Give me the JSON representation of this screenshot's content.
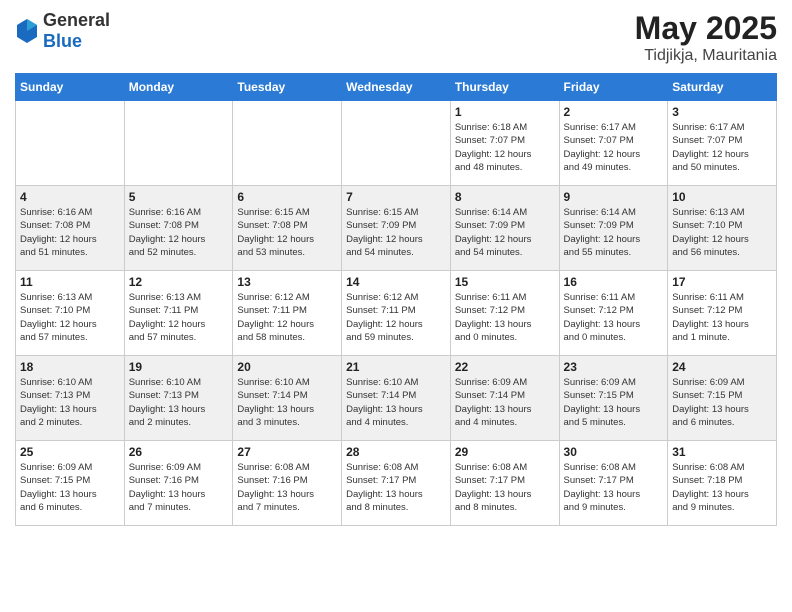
{
  "header": {
    "logo_general": "General",
    "logo_blue": "Blue",
    "month": "May 2025",
    "location": "Tidjikja, Mauritania"
  },
  "days_of_week": [
    "Sunday",
    "Monday",
    "Tuesday",
    "Wednesday",
    "Thursday",
    "Friday",
    "Saturday"
  ],
  "weeks": [
    [
      {
        "day": "",
        "info": ""
      },
      {
        "day": "",
        "info": ""
      },
      {
        "day": "",
        "info": ""
      },
      {
        "day": "",
        "info": ""
      },
      {
        "day": "1",
        "info": "Sunrise: 6:18 AM\nSunset: 7:07 PM\nDaylight: 12 hours\nand 48 minutes."
      },
      {
        "day": "2",
        "info": "Sunrise: 6:17 AM\nSunset: 7:07 PM\nDaylight: 12 hours\nand 49 minutes."
      },
      {
        "day": "3",
        "info": "Sunrise: 6:17 AM\nSunset: 7:07 PM\nDaylight: 12 hours\nand 50 minutes."
      }
    ],
    [
      {
        "day": "4",
        "info": "Sunrise: 6:16 AM\nSunset: 7:08 PM\nDaylight: 12 hours\nand 51 minutes."
      },
      {
        "day": "5",
        "info": "Sunrise: 6:16 AM\nSunset: 7:08 PM\nDaylight: 12 hours\nand 52 minutes."
      },
      {
        "day": "6",
        "info": "Sunrise: 6:15 AM\nSunset: 7:08 PM\nDaylight: 12 hours\nand 53 minutes."
      },
      {
        "day": "7",
        "info": "Sunrise: 6:15 AM\nSunset: 7:09 PM\nDaylight: 12 hours\nand 54 minutes."
      },
      {
        "day": "8",
        "info": "Sunrise: 6:14 AM\nSunset: 7:09 PM\nDaylight: 12 hours\nand 54 minutes."
      },
      {
        "day": "9",
        "info": "Sunrise: 6:14 AM\nSunset: 7:09 PM\nDaylight: 12 hours\nand 55 minutes."
      },
      {
        "day": "10",
        "info": "Sunrise: 6:13 AM\nSunset: 7:10 PM\nDaylight: 12 hours\nand 56 minutes."
      }
    ],
    [
      {
        "day": "11",
        "info": "Sunrise: 6:13 AM\nSunset: 7:10 PM\nDaylight: 12 hours\nand 57 minutes."
      },
      {
        "day": "12",
        "info": "Sunrise: 6:13 AM\nSunset: 7:11 PM\nDaylight: 12 hours\nand 57 minutes."
      },
      {
        "day": "13",
        "info": "Sunrise: 6:12 AM\nSunset: 7:11 PM\nDaylight: 12 hours\nand 58 minutes."
      },
      {
        "day": "14",
        "info": "Sunrise: 6:12 AM\nSunset: 7:11 PM\nDaylight: 12 hours\nand 59 minutes."
      },
      {
        "day": "15",
        "info": "Sunrise: 6:11 AM\nSunset: 7:12 PM\nDaylight: 13 hours\nand 0 minutes."
      },
      {
        "day": "16",
        "info": "Sunrise: 6:11 AM\nSunset: 7:12 PM\nDaylight: 13 hours\nand 0 minutes."
      },
      {
        "day": "17",
        "info": "Sunrise: 6:11 AM\nSunset: 7:12 PM\nDaylight: 13 hours\nand 1 minute."
      }
    ],
    [
      {
        "day": "18",
        "info": "Sunrise: 6:10 AM\nSunset: 7:13 PM\nDaylight: 13 hours\nand 2 minutes."
      },
      {
        "day": "19",
        "info": "Sunrise: 6:10 AM\nSunset: 7:13 PM\nDaylight: 13 hours\nand 2 minutes."
      },
      {
        "day": "20",
        "info": "Sunrise: 6:10 AM\nSunset: 7:14 PM\nDaylight: 13 hours\nand 3 minutes."
      },
      {
        "day": "21",
        "info": "Sunrise: 6:10 AM\nSunset: 7:14 PM\nDaylight: 13 hours\nand 4 minutes."
      },
      {
        "day": "22",
        "info": "Sunrise: 6:09 AM\nSunset: 7:14 PM\nDaylight: 13 hours\nand 4 minutes."
      },
      {
        "day": "23",
        "info": "Sunrise: 6:09 AM\nSunset: 7:15 PM\nDaylight: 13 hours\nand 5 minutes."
      },
      {
        "day": "24",
        "info": "Sunrise: 6:09 AM\nSunset: 7:15 PM\nDaylight: 13 hours\nand 6 minutes."
      }
    ],
    [
      {
        "day": "25",
        "info": "Sunrise: 6:09 AM\nSunset: 7:15 PM\nDaylight: 13 hours\nand 6 minutes."
      },
      {
        "day": "26",
        "info": "Sunrise: 6:09 AM\nSunset: 7:16 PM\nDaylight: 13 hours\nand 7 minutes."
      },
      {
        "day": "27",
        "info": "Sunrise: 6:08 AM\nSunset: 7:16 PM\nDaylight: 13 hours\nand 7 minutes."
      },
      {
        "day": "28",
        "info": "Sunrise: 6:08 AM\nSunset: 7:17 PM\nDaylight: 13 hours\nand 8 minutes."
      },
      {
        "day": "29",
        "info": "Sunrise: 6:08 AM\nSunset: 7:17 PM\nDaylight: 13 hours\nand 8 minutes."
      },
      {
        "day": "30",
        "info": "Sunrise: 6:08 AM\nSunset: 7:17 PM\nDaylight: 13 hours\nand 9 minutes."
      },
      {
        "day": "31",
        "info": "Sunrise: 6:08 AM\nSunset: 7:18 PM\nDaylight: 13 hours\nand 9 minutes."
      }
    ]
  ]
}
